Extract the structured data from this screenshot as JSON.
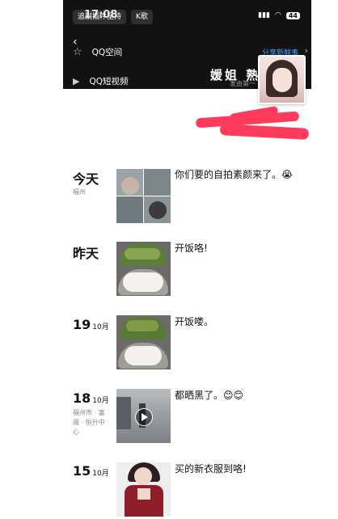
{
  "status": {
    "time": "17:08",
    "chips": [
      "追剧插件坚持",
      "K歌"
    ],
    "battery": "44"
  },
  "menu": {
    "items": [
      {
        "label": "QQ空间",
        "icon": "star-icon"
      },
      {
        "label": "QQ短视频",
        "icon": "video-icon"
      }
    ],
    "share_label": "分享新鲜事"
  },
  "cover": {
    "name": "媛姐 熟",
    "subtitle": "发由第一"
  },
  "posts": [
    {
      "day": "今天",
      "month": "",
      "location": "福州",
      "text": "你们要的自拍素颜来了。😭"
    },
    {
      "day": "昨天",
      "month": "",
      "location": "",
      "text": "开饭咯!"
    },
    {
      "day": "19",
      "month": "10月",
      "location": "",
      "text": "开饭喽。"
    },
    {
      "day": "18",
      "month": "10月",
      "location": "福州市 · 富闽 · 恒升中心",
      "text": "都晒黑了。😊😊"
    },
    {
      "day": "15",
      "month": "10月",
      "location": "",
      "text": "买的新衣服到咯!"
    }
  ]
}
